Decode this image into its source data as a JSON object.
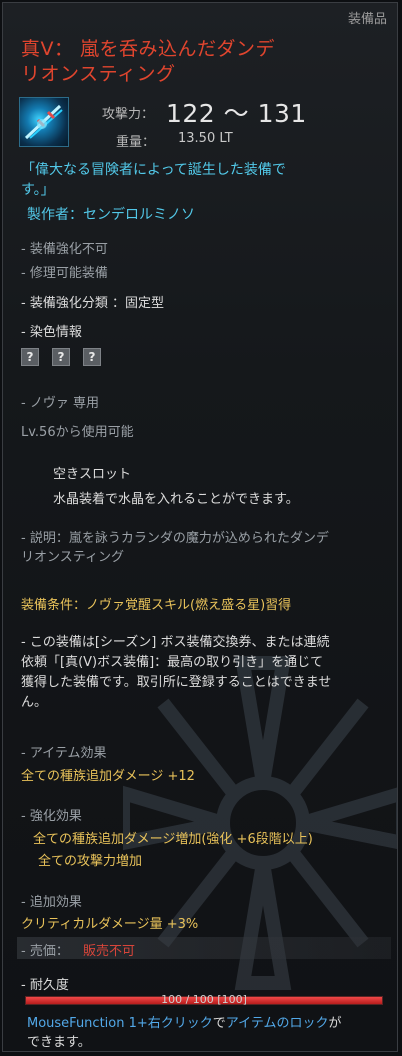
{
  "category": "装備品",
  "title_line1": "真V： 嵐を呑み込んだダンデ",
  "title_line2": "リオンスティング",
  "stats": {
    "attack_label": "攻撃力：",
    "attack_value": "122 ～ 131",
    "weight_label": "重量：",
    "weight_value": "13.50 LT"
  },
  "flavor_line1": "「偉大なる冒険者によって誕生した装備で",
  "flavor_line2": "す。」",
  "maker": "製作者：センデロルミノソ",
  "no_enhance": "- 装備強化不可",
  "repairable": "- 修理可能装備",
  "enhance_type": "- 装備強化分類 ：固定型",
  "dye_info": "- 染色情報",
  "dye_slots": [
    "?",
    "?",
    "?"
  ],
  "class_only": "- ノヴァ 専用",
  "level_req": "Lv.56から使用可能",
  "empty_slot": "空きスロット",
  "crystal_text": "水晶装着で水晶を入れることができます。",
  "desc_line1": "- 説明：嵐を詠うカランダの魔力が込められたダンデ",
  "desc_line2": "リオンスティング",
  "equip_condition": "装備条件：ノヴァ覚醒スキル(燃え盛る星)習得",
  "note_line1": " - この装備は[シーズン] ボス装備交換券、または連続",
  "note_line2": "依頼「[真(V)ボス装備]：最高の取り引き」を通じて",
  "note_line3": "獲得した装備です。取引所に登録することはできませ",
  "note_line4": "ん。",
  "item_effect_title": "- アイテム効果",
  "item_effect_1": "全ての種族追加ダメージ +12",
  "enhance_effect_title": "- 強化効果",
  "enhance_effect_1": "全ての種族追加ダメージ増加(強化 +6段階以上)",
  "enhance_effect_2": "全ての攻撃力増加",
  "extra_effect_title": "- 追加効果",
  "extra_effect_1": "クリティカルダメージ量 +3%",
  "price_label": "- 売価：",
  "price_value": "販売不可",
  "durability_label": "- 耐久度",
  "durability_text": "100 / 100 [100]",
  "durability_fraction": 1.0,
  "footer_part1": "MouseFunction 1+右クリック",
  "footer_part2": "で",
  "footer_part3": "アイテムのロック",
  "footer_part4": "が",
  "footer_line2": "できます。"
}
